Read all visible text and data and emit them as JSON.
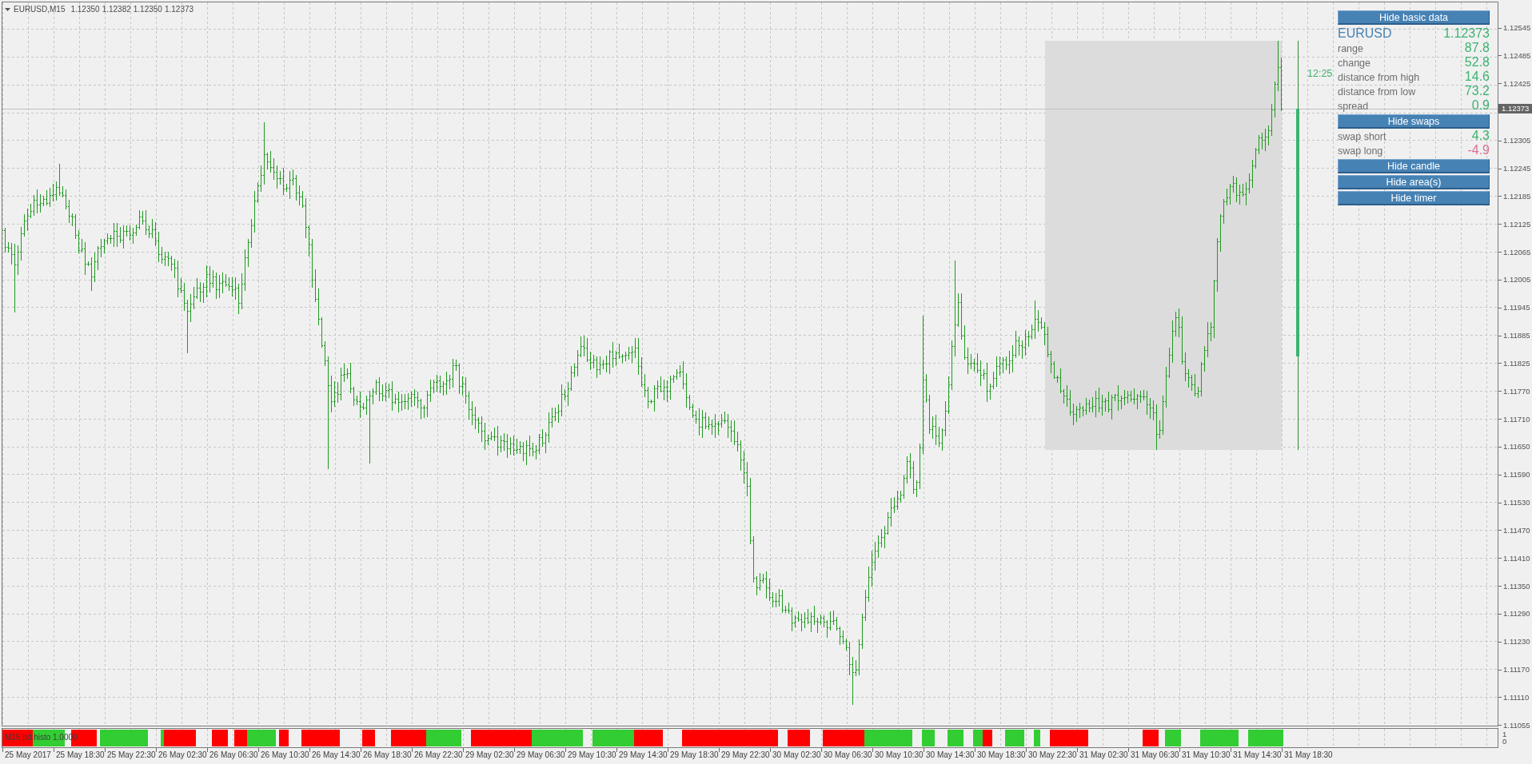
{
  "chart_header": {
    "symbol": "EURUSD,M15",
    "quotes": [
      "1.12350",
      "1.12382",
      "1.12350",
      "1.12373"
    ]
  },
  "info_panel": [
    {
      "kind": "button",
      "label": "Hide basic data"
    },
    {
      "kind": "header",
      "label": "EURUSD",
      "value": "1.12373"
    },
    {
      "kind": "row",
      "label": "range",
      "value": "87.8",
      "color": "#3cb371"
    },
    {
      "kind": "row",
      "label": "change",
      "value": "52.8",
      "color": "#3cb371"
    },
    {
      "kind": "row",
      "label": "distance from high",
      "value": "14.6",
      "color": "#3cb371"
    },
    {
      "kind": "row",
      "label": "distance from low",
      "value": "73.2",
      "color": "#3cb371"
    },
    {
      "kind": "row",
      "label": "spread",
      "value": "0.9",
      "color": "#3cb371"
    },
    {
      "kind": "button",
      "label": "Hide swaps"
    },
    {
      "kind": "row",
      "label": "swap short",
      "value": "4.3",
      "color": "#3cb371"
    },
    {
      "kind": "row",
      "label": "swap long",
      "value": "-4.9",
      "color": "#db7093"
    },
    {
      "kind": "button",
      "label": "Hide candle"
    },
    {
      "kind": "button",
      "label": "Hide area(s)"
    },
    {
      "kind": "button",
      "label": "Hide timer"
    }
  ],
  "timer": "12:25",
  "price_axis": [
    {
      "kind": "tick",
      "text": "1.12545"
    },
    {
      "kind": "tick",
      "text": "1.12485"
    },
    {
      "kind": "tick",
      "text": "1.12425"
    },
    {
      "kind": "current",
      "text": "1.12373"
    },
    {
      "kind": "tick",
      "text": "1.12305"
    },
    {
      "kind": "tick",
      "text": "1.12245"
    },
    {
      "kind": "tick",
      "text": "1.12185"
    },
    {
      "kind": "tick",
      "text": "1.12125"
    },
    {
      "kind": "tick",
      "text": "1.12065"
    },
    {
      "kind": "tick",
      "text": "1.12005"
    },
    {
      "kind": "tick",
      "text": "1.11945"
    },
    {
      "kind": "tick",
      "text": "1.11885"
    },
    {
      "kind": "tick",
      "text": "1.11825"
    },
    {
      "kind": "tick",
      "text": "1.11770"
    },
    {
      "kind": "tick",
      "text": "1.11710"
    },
    {
      "kind": "tick",
      "text": "1.11650"
    },
    {
      "kind": "tick",
      "text": "1.11590"
    },
    {
      "kind": "tick",
      "text": "1.11530"
    },
    {
      "kind": "tick",
      "text": "1.11470"
    },
    {
      "kind": "tick",
      "text": "1.11410"
    },
    {
      "kind": "tick",
      "text": "1.11350"
    },
    {
      "kind": "tick",
      "text": "1.11290"
    },
    {
      "kind": "tick",
      "text": "1.11230"
    },
    {
      "kind": "tick",
      "text": "1.11170"
    },
    {
      "kind": "tick",
      "text": "1.11110"
    },
    {
      "kind": "tick",
      "text": "1.11055"
    }
  ],
  "indicator": {
    "title": "M15 pd histo 1.0000",
    "scale": [
      "1",
      "0"
    ]
  },
  "time_axis": [
    "25 May 2017",
    "25 May 18:30",
    "25 May 22:30",
    "26 May 02:30",
    "26 May 06:30",
    "26 May 10:30",
    "26 May 14:30",
    "26 May 18:30",
    "26 May 22:30",
    "29 May 02:30",
    "29 May 06:30",
    "29 May 10:30",
    "29 May 14:30",
    "29 May 18:30",
    "29 May 22:30",
    "30 May 02:30",
    "30 May 06:30",
    "30 May 10:30",
    "30 May 14:30",
    "30 May 18:30",
    "30 May 22:30",
    "31 May 02:30",
    "31 May 06:30",
    "31 May 10:30",
    "31 May 14:30",
    "31 May 18:30"
  ]
}
